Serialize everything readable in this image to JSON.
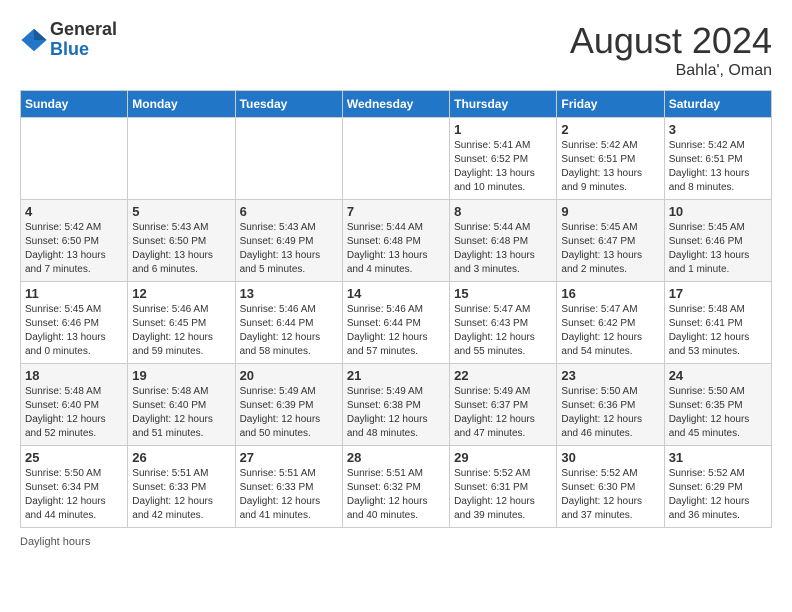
{
  "header": {
    "logo_line1": "General",
    "logo_line2": "Blue",
    "month_year": "August 2024",
    "location": "Bahla', Oman"
  },
  "weekdays": [
    "Sunday",
    "Monday",
    "Tuesday",
    "Wednesday",
    "Thursday",
    "Friday",
    "Saturday"
  ],
  "weeks": [
    [
      {
        "day": "",
        "info": ""
      },
      {
        "day": "",
        "info": ""
      },
      {
        "day": "",
        "info": ""
      },
      {
        "day": "",
        "info": ""
      },
      {
        "day": "1",
        "info": "Sunrise: 5:41 AM\nSunset: 6:52 PM\nDaylight: 13 hours and 10 minutes."
      },
      {
        "day": "2",
        "info": "Sunrise: 5:42 AM\nSunset: 6:51 PM\nDaylight: 13 hours and 9 minutes."
      },
      {
        "day": "3",
        "info": "Sunrise: 5:42 AM\nSunset: 6:51 PM\nDaylight: 13 hours and 8 minutes."
      }
    ],
    [
      {
        "day": "4",
        "info": "Sunrise: 5:42 AM\nSunset: 6:50 PM\nDaylight: 13 hours and 7 minutes."
      },
      {
        "day": "5",
        "info": "Sunrise: 5:43 AM\nSunset: 6:50 PM\nDaylight: 13 hours and 6 minutes."
      },
      {
        "day": "6",
        "info": "Sunrise: 5:43 AM\nSunset: 6:49 PM\nDaylight: 13 hours and 5 minutes."
      },
      {
        "day": "7",
        "info": "Sunrise: 5:44 AM\nSunset: 6:48 PM\nDaylight: 13 hours and 4 minutes."
      },
      {
        "day": "8",
        "info": "Sunrise: 5:44 AM\nSunset: 6:48 PM\nDaylight: 13 hours and 3 minutes."
      },
      {
        "day": "9",
        "info": "Sunrise: 5:45 AM\nSunset: 6:47 PM\nDaylight: 13 hours and 2 minutes."
      },
      {
        "day": "10",
        "info": "Sunrise: 5:45 AM\nSunset: 6:46 PM\nDaylight: 13 hours and 1 minute."
      }
    ],
    [
      {
        "day": "11",
        "info": "Sunrise: 5:45 AM\nSunset: 6:46 PM\nDaylight: 13 hours and 0 minutes."
      },
      {
        "day": "12",
        "info": "Sunrise: 5:46 AM\nSunset: 6:45 PM\nDaylight: 12 hours and 59 minutes."
      },
      {
        "day": "13",
        "info": "Sunrise: 5:46 AM\nSunset: 6:44 PM\nDaylight: 12 hours and 58 minutes."
      },
      {
        "day": "14",
        "info": "Sunrise: 5:46 AM\nSunset: 6:44 PM\nDaylight: 12 hours and 57 minutes."
      },
      {
        "day": "15",
        "info": "Sunrise: 5:47 AM\nSunset: 6:43 PM\nDaylight: 12 hours and 55 minutes."
      },
      {
        "day": "16",
        "info": "Sunrise: 5:47 AM\nSunset: 6:42 PM\nDaylight: 12 hours and 54 minutes."
      },
      {
        "day": "17",
        "info": "Sunrise: 5:48 AM\nSunset: 6:41 PM\nDaylight: 12 hours and 53 minutes."
      }
    ],
    [
      {
        "day": "18",
        "info": "Sunrise: 5:48 AM\nSunset: 6:40 PM\nDaylight: 12 hours and 52 minutes."
      },
      {
        "day": "19",
        "info": "Sunrise: 5:48 AM\nSunset: 6:40 PM\nDaylight: 12 hours and 51 minutes."
      },
      {
        "day": "20",
        "info": "Sunrise: 5:49 AM\nSunset: 6:39 PM\nDaylight: 12 hours and 50 minutes."
      },
      {
        "day": "21",
        "info": "Sunrise: 5:49 AM\nSunset: 6:38 PM\nDaylight: 12 hours and 48 minutes."
      },
      {
        "day": "22",
        "info": "Sunrise: 5:49 AM\nSunset: 6:37 PM\nDaylight: 12 hours and 47 minutes."
      },
      {
        "day": "23",
        "info": "Sunrise: 5:50 AM\nSunset: 6:36 PM\nDaylight: 12 hours and 46 minutes."
      },
      {
        "day": "24",
        "info": "Sunrise: 5:50 AM\nSunset: 6:35 PM\nDaylight: 12 hours and 45 minutes."
      }
    ],
    [
      {
        "day": "25",
        "info": "Sunrise: 5:50 AM\nSunset: 6:34 PM\nDaylight: 12 hours and 44 minutes."
      },
      {
        "day": "26",
        "info": "Sunrise: 5:51 AM\nSunset: 6:33 PM\nDaylight: 12 hours and 42 minutes."
      },
      {
        "day": "27",
        "info": "Sunrise: 5:51 AM\nSunset: 6:33 PM\nDaylight: 12 hours and 41 minutes."
      },
      {
        "day": "28",
        "info": "Sunrise: 5:51 AM\nSunset: 6:32 PM\nDaylight: 12 hours and 40 minutes."
      },
      {
        "day": "29",
        "info": "Sunrise: 5:52 AM\nSunset: 6:31 PM\nDaylight: 12 hours and 39 minutes."
      },
      {
        "day": "30",
        "info": "Sunrise: 5:52 AM\nSunset: 6:30 PM\nDaylight: 12 hours and 37 minutes."
      },
      {
        "day": "31",
        "info": "Sunrise: 5:52 AM\nSunset: 6:29 PM\nDaylight: 12 hours and 36 minutes."
      }
    ]
  ],
  "footer": {
    "daylight_label": "Daylight hours"
  }
}
